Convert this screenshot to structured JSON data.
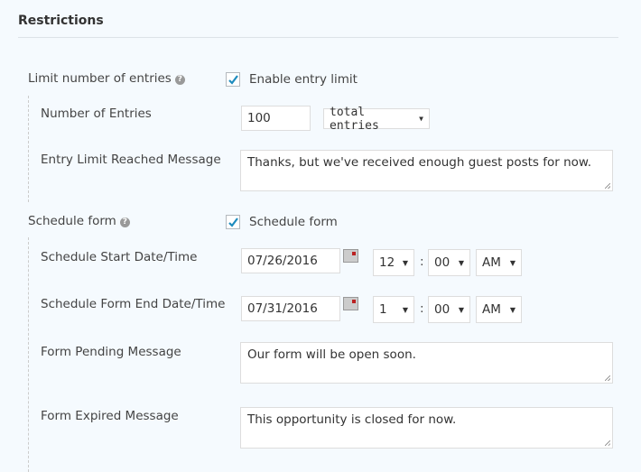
{
  "section": {
    "title": "Restrictions"
  },
  "limit": {
    "label": "Limit number of entries",
    "help_icon": "question-circle-icon",
    "checkbox_label": "Enable entry limit",
    "checked": true,
    "number_label": "Number of Entries",
    "number_value": "100",
    "type_value": "total entries",
    "message_label": "Entry Limit Reached Message",
    "message_value": "Thanks, but we've received enough guest posts for now."
  },
  "schedule": {
    "label": "Schedule form",
    "help_icon": "question-circle-icon",
    "checkbox_label": "Schedule form",
    "checked": true,
    "start_label": "Schedule Start Date/Time",
    "start_date": "07/26/2016",
    "start_hour": "12",
    "start_min": "00",
    "start_ampm": "AM",
    "end_label": "Schedule Form End Date/Time",
    "end_date": "07/31/2016",
    "end_hour": "1",
    "end_min": "00",
    "end_ampm": "AM",
    "colon": ":",
    "pending_label": "Form Pending Message",
    "pending_value": "Our form will be open soon.",
    "expired_label": "Form Expired Message",
    "expired_value": "This opportunity is closed for now."
  },
  "colors": {
    "accent": "#1e8cbe",
    "background": "#f5fafe"
  }
}
